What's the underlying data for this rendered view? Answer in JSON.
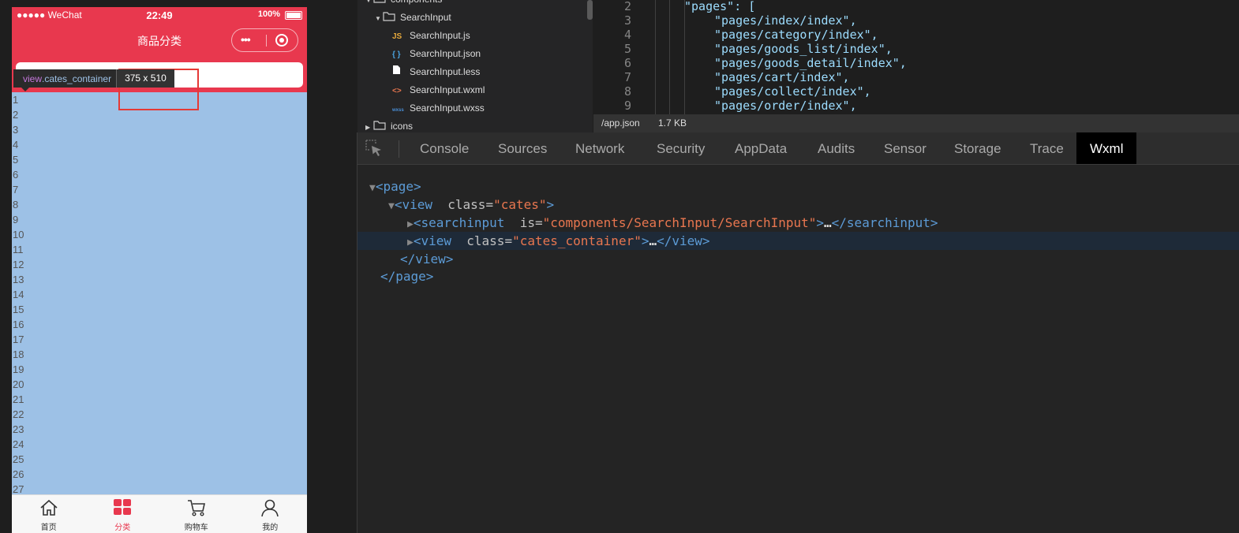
{
  "phone": {
    "status_bar": {
      "carrier": "●●●●● WeChat",
      "time": "22:49",
      "battery": "100%"
    },
    "nav_title": "商品分类",
    "capsule_dots": "•••",
    "tooltip": {
      "tag": "view",
      "class": ".cates_container",
      "size": "375 x 510"
    },
    "list_numbers": [
      "1",
      "2",
      "3",
      "4",
      "5",
      "6",
      "7",
      "8",
      "9",
      "10",
      "11",
      "12",
      "13",
      "14",
      "15",
      "16",
      "17",
      "18",
      "19",
      "20",
      "21",
      "22",
      "23",
      "24",
      "25",
      "26",
      "27"
    ],
    "tabs": [
      {
        "label": "首页",
        "icon": "home-icon",
        "active": false
      },
      {
        "label": "分类",
        "icon": "category-grid-icon",
        "active": true
      },
      {
        "label": "购物车",
        "icon": "cart-icon",
        "active": false
      },
      {
        "label": "我的",
        "icon": "user-icon",
        "active": false
      }
    ],
    "colors": {
      "brand": "#e8384e",
      "highlight": "#9dc1e6"
    }
  },
  "file_tree": {
    "items": [
      {
        "label": "components",
        "type": "folder",
        "expanded": true
      },
      {
        "label": "SearchInput",
        "type": "folder",
        "expanded": true
      },
      {
        "label": "SearchInput.js",
        "type": "js",
        "icon_text": "JS"
      },
      {
        "label": "SearchInput.json",
        "type": "json",
        "icon_text": "{ }"
      },
      {
        "label": "SearchInput.less",
        "type": "less",
        "icon_text": ""
      },
      {
        "label": "SearchInput.wxml",
        "type": "wxml",
        "icon_text": "<>"
      },
      {
        "label": "SearchInput.wxss",
        "type": "wxss",
        "icon_text": "wxss"
      },
      {
        "label": "icons",
        "type": "folder",
        "expanded": false
      }
    ]
  },
  "editor": {
    "lines": [
      {
        "num": "2",
        "text": "\"pages\": ["
      },
      {
        "num": "3",
        "text": "\"pages/index/index\","
      },
      {
        "num": "4",
        "text": "\"pages/category/index\","
      },
      {
        "num": "5",
        "text": "\"pages/goods_list/index\","
      },
      {
        "num": "6",
        "text": "\"pages/goods_detail/index\","
      },
      {
        "num": "7",
        "text": "\"pages/cart/index\","
      },
      {
        "num": "8",
        "text": "\"pages/collect/index\","
      },
      {
        "num": "9",
        "text": "\"pages/order/index\","
      }
    ],
    "status": {
      "file": "/app.json",
      "size": "1.7 KB"
    }
  },
  "devtools": {
    "tabs": [
      "Console",
      "Sources",
      "Network",
      "Security",
      "AppData",
      "Audits",
      "Sensor",
      "Storage",
      "Trace",
      "Wxml"
    ],
    "active_tab": "Wxml",
    "wxml": {
      "page_open": "<page>",
      "view_open": "<view",
      "view_attr_name": "class",
      "view_attr_value": "\"cates\"",
      "view_open_end": ">",
      "search_open": "<searchinput",
      "search_attr_name": "is",
      "search_attr_value": "\"components/SearchInput/SearchInput\"",
      "search_rest": "></searchinput>",
      "container_open": "<view",
      "container_attr_name": "class",
      "container_attr_value": "\"cates_container\"",
      "container_rest": "></view>",
      "ellipsis": "…",
      "view_close": "</view>",
      "page_close": "</page>"
    }
  }
}
